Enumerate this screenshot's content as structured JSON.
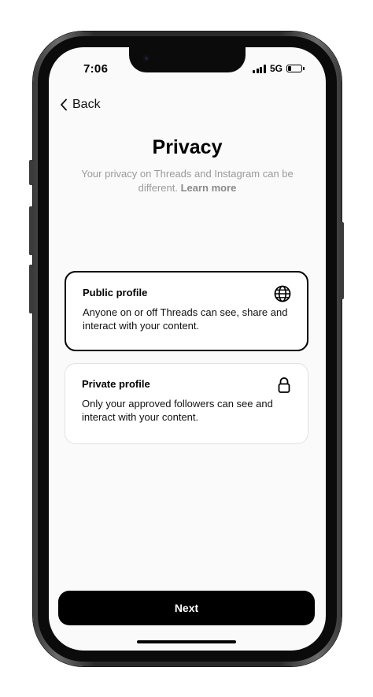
{
  "status_bar": {
    "time": "7:06",
    "network": "5G",
    "battery_level": 0.25
  },
  "nav": {
    "back_label": "Back",
    "back_icon": "chevron-left-icon"
  },
  "page": {
    "title": "Privacy",
    "subtitle": "Your privacy on Threads and Instagram can be different.",
    "learn_more": "Learn more"
  },
  "options": [
    {
      "title": "Public profile",
      "description": "Anyone on or off Threads can see, share and interact with your content.",
      "icon": "globe-icon",
      "selected": true
    },
    {
      "title": "Private profile",
      "description": "Only your approved followers can see and interact with your content.",
      "icon": "lock-icon",
      "selected": false
    }
  ],
  "footer": {
    "next_label": "Next"
  },
  "colors": {
    "background": "#fafafa",
    "primary": "#000000",
    "muted_text": "#9a9a9a",
    "card_border_unselected": "#e2e2e2"
  }
}
